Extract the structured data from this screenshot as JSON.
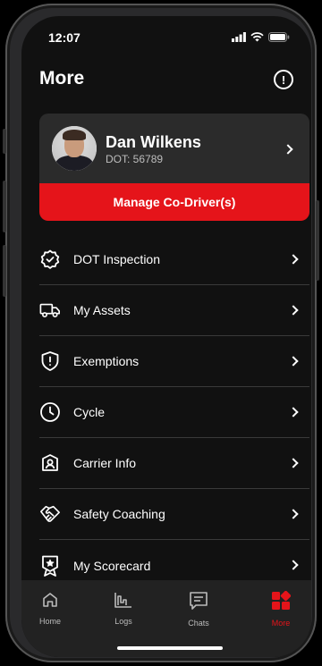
{
  "status": {
    "time": "12:07"
  },
  "header": {
    "title": "More"
  },
  "profile": {
    "name": "Dan Wilkens",
    "dot": "DOT: 56789"
  },
  "manage_label": "Manage Co-Driver(s)",
  "menu": [
    {
      "label": "DOT Inspection",
      "icon": "badge-check-icon"
    },
    {
      "label": "My Assets",
      "icon": "truck-icon"
    },
    {
      "label": "Exemptions",
      "icon": "shield-alert-icon"
    },
    {
      "label": "Cycle",
      "icon": "clock-icon"
    },
    {
      "label": "Carrier Info",
      "icon": "id-card-icon"
    },
    {
      "label": "Safety Coaching",
      "icon": "handshake-icon"
    },
    {
      "label": "My Scorecard",
      "icon": "award-icon"
    }
  ],
  "tabs": [
    {
      "label": "Home",
      "icon": "home-icon"
    },
    {
      "label": "Logs",
      "icon": "logs-chart-icon"
    },
    {
      "label": "Chats",
      "icon": "chat-icon"
    },
    {
      "label": "More",
      "icon": "grid-icon",
      "active": true
    }
  ],
  "colors": {
    "accent": "#e5141a",
    "background": "#111111",
    "card": "#2b2b2b"
  }
}
